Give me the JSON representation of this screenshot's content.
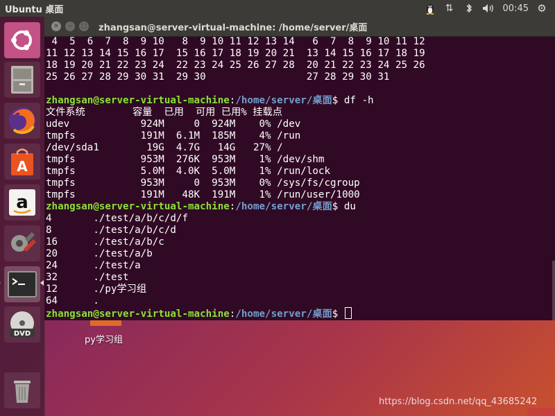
{
  "topbar": {
    "title": "Ubuntu 桌面",
    "clock": "00:45"
  },
  "launcher": {
    "items": [
      {
        "name": "ubuntu-dash"
      },
      {
        "name": "files"
      },
      {
        "name": "firefox"
      },
      {
        "name": "software-center"
      },
      {
        "name": "amazon"
      },
      {
        "name": "system-settings"
      },
      {
        "name": "terminal"
      },
      {
        "name": "dvd"
      },
      {
        "name": "trash"
      }
    ]
  },
  "terminal": {
    "title": "zhangsan@server-virtual-machine: /home/server/桌面",
    "lines": [
      {
        "type": "text",
        "text": " 4  5  6  7  8  9 10   8  9 10 11 12 13 14   6  7  8  9 10 11 12"
      },
      {
        "type": "text",
        "text": "11 12 13 14 15 16 17  15 16 17 18 19 20 21  13 14 15 16 17 18 19"
      },
      {
        "type": "text",
        "text": "18 19 20 21 22 23 24  22 23 24 25 26 27 28  20 21 22 23 24 25 26"
      },
      {
        "type": "text",
        "text": "25 26 27 28 29 30 31  29 30                 27 28 29 30 31"
      },
      {
        "type": "text",
        "text": ""
      },
      {
        "type": "prompt",
        "user": "zhangsan@server-virtual-machine",
        "path": "/home/server/桌面",
        "cmd": "$ df -h"
      },
      {
        "type": "text",
        "text": "文件系统        容量  已用  可用 已用% 挂载点"
      },
      {
        "type": "text",
        "text": "udev            924M     0  924M    0% /dev"
      },
      {
        "type": "text",
        "text": "tmpfs           191M  6.1M  185M    4% /run"
      },
      {
        "type": "text",
        "text": "/dev/sda1        19G  4.7G   14G   27% /"
      },
      {
        "type": "text",
        "text": "tmpfs           953M  276K  953M    1% /dev/shm"
      },
      {
        "type": "text",
        "text": "tmpfs           5.0M  4.0K  5.0M    1% /run/lock"
      },
      {
        "type": "text",
        "text": "tmpfs           953M     0  953M    0% /sys/fs/cgroup"
      },
      {
        "type": "text",
        "text": "tmpfs           191M   48K  191M    1% /run/user/1000"
      },
      {
        "type": "prompt",
        "user": "zhangsan@server-virtual-machine",
        "path": "/home/server/桌面",
        "cmd": "$ du"
      },
      {
        "type": "text",
        "text": "4       ./test/a/b/c/d/f"
      },
      {
        "type": "text",
        "text": "8       ./test/a/b/c/d"
      },
      {
        "type": "text",
        "text": "16      ./test/a/b/c"
      },
      {
        "type": "text",
        "text": "20      ./test/a/b"
      },
      {
        "type": "text",
        "text": "24      ./test/a"
      },
      {
        "type": "text",
        "text": "32      ./test"
      },
      {
        "type": "text",
        "text": "12      ./py学习组"
      },
      {
        "type": "text",
        "text": "64      ."
      },
      {
        "type": "prompt",
        "user": "zhangsan@server-virtual-machine",
        "path": "/home/server/桌面",
        "cmd": "$ ",
        "cursor": true
      }
    ]
  },
  "desktop": {
    "icon_label": "py学习组",
    "watermark": "https://blog.csdn.net/qq_43685242"
  }
}
